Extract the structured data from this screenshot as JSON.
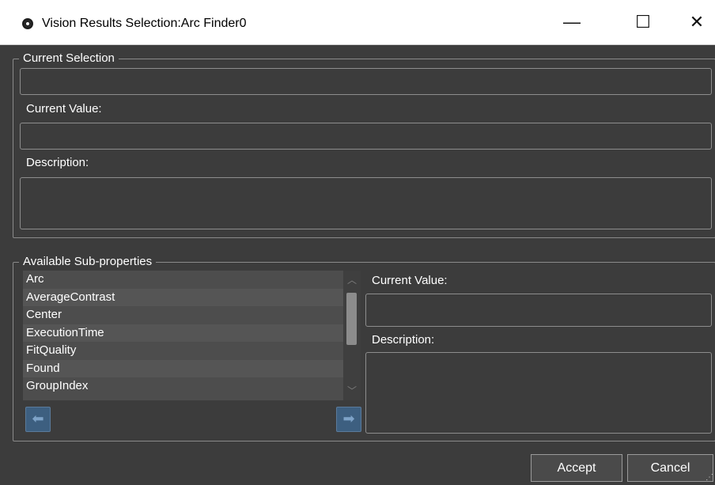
{
  "window": {
    "title": "Vision Results Selection:Arc Finder0",
    "app_icon": "vision-target-icon",
    "controls": {
      "minimize": "—",
      "maximize": "☐",
      "close": "✕"
    }
  },
  "current_selection": {
    "legend": "Current Selection",
    "selection_value": "",
    "current_value_label": "Current Value:",
    "current_value": "",
    "description_label": "Description:",
    "description": ""
  },
  "sub_properties": {
    "legend": "Available Sub-properties",
    "items": [
      "Arc",
      "AverageContrast",
      "Center",
      "ExecutionTime",
      "FitQuality",
      "Found",
      "GroupIndex"
    ],
    "current_value_label": "Current Value:",
    "current_value": "",
    "description_label": "Description:",
    "description": "",
    "back_icon": "arrow-left-icon",
    "forward_icon": "arrow-right-icon"
  },
  "buttons": {
    "accept": "Accept",
    "cancel": "Cancel"
  },
  "colors": {
    "background": "#3c3c3c",
    "titlebar": "#ffffff",
    "accent": "#3d5f80"
  }
}
